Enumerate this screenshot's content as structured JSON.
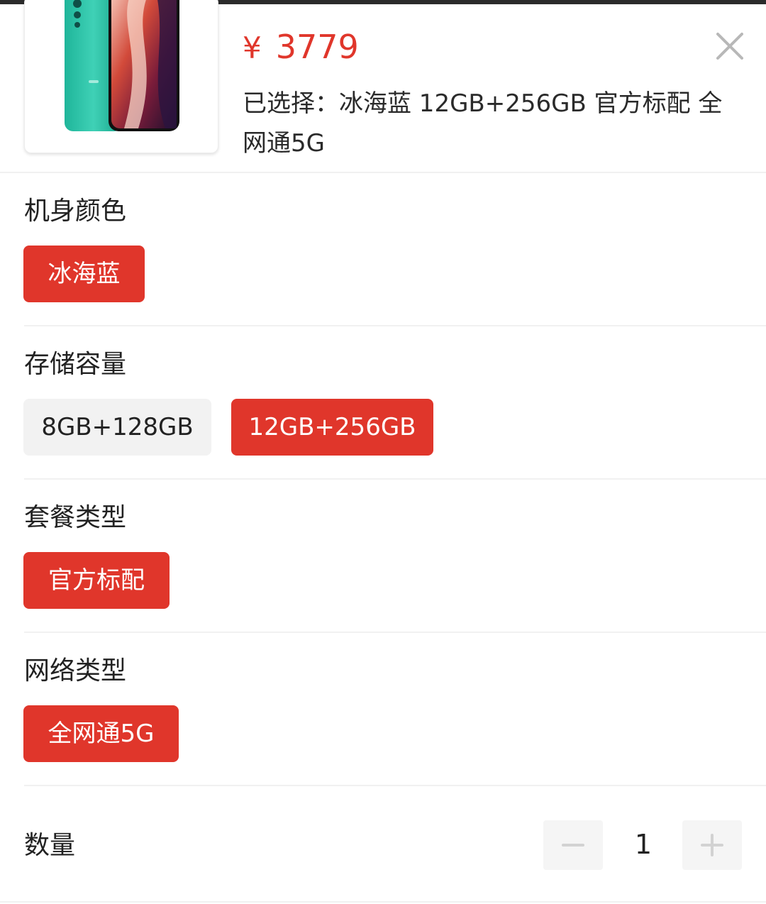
{
  "product": {
    "currency": "¥",
    "price": "3779",
    "selected_text": "已选择：冰海蓝 12GB+256GB 官方标配 全网通5G",
    "image_icon": "phone-product-image"
  },
  "groups": [
    {
      "title": "机身颜色",
      "options": [
        {
          "label": "冰海蓝",
          "selected": true
        }
      ]
    },
    {
      "title": "存储容量",
      "options": [
        {
          "label": "8GB+128GB",
          "selected": false
        },
        {
          "label": "12GB+256GB",
          "selected": true
        }
      ]
    },
    {
      "title": "套餐类型",
      "options": [
        {
          "label": "官方标配",
          "selected": true
        }
      ]
    },
    {
      "title": "网络类型",
      "options": [
        {
          "label": "全网通5G",
          "selected": true
        }
      ]
    }
  ],
  "quantity": {
    "label": "数量",
    "value": "1",
    "minus_icon": "minus-icon",
    "plus_icon": "plus-icon"
  },
  "colors": {
    "accent": "#e0362b",
    "option_inactive_bg": "#f2f2f2",
    "stepper_bg": "#f5f5f5"
  },
  "icons": {
    "close": "close-icon"
  }
}
